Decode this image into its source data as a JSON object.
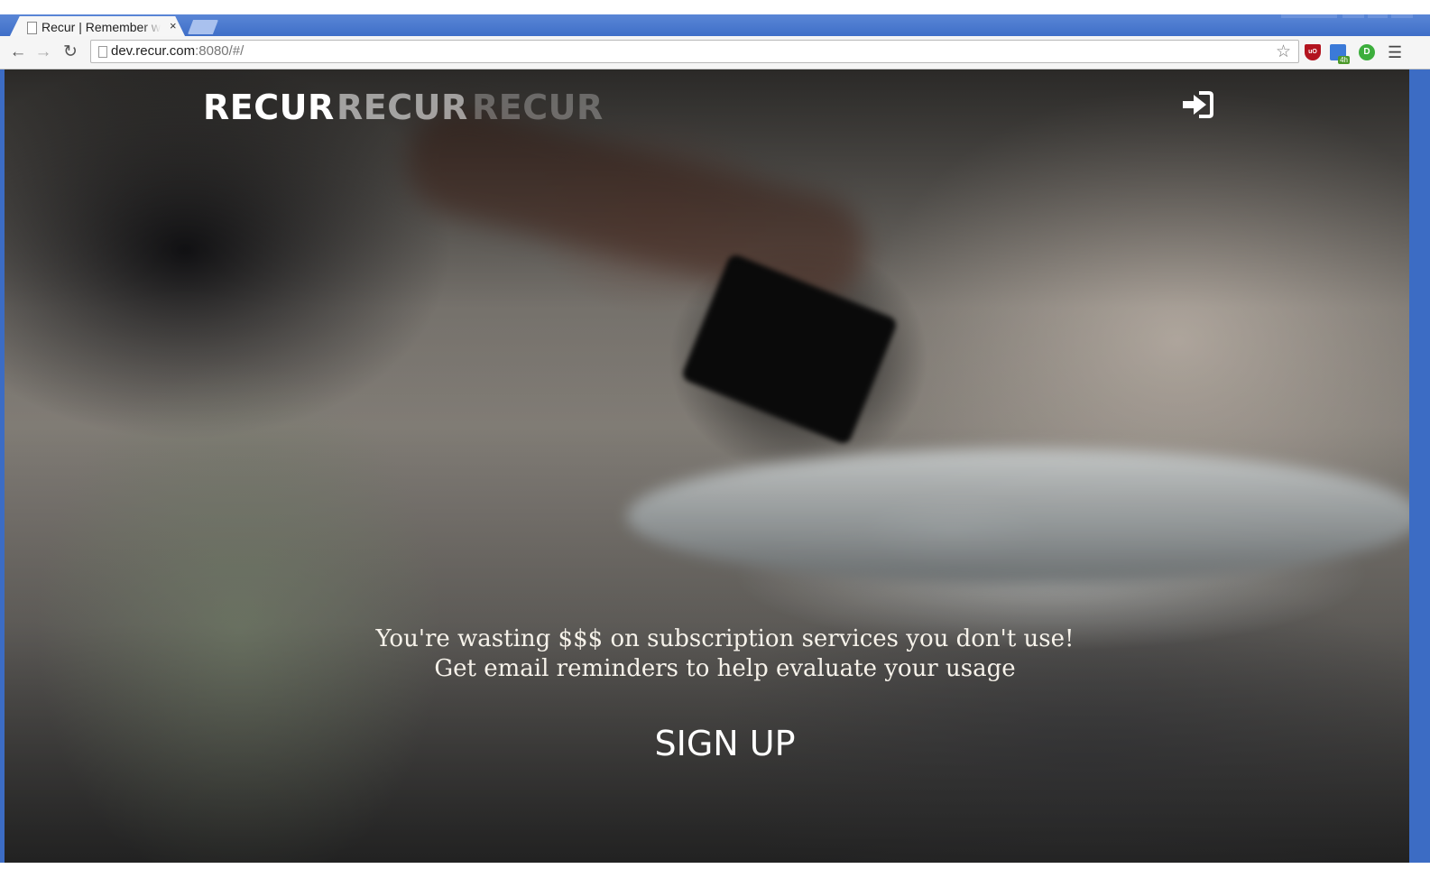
{
  "browser": {
    "tab_title": "Recur | Remember w",
    "tab_close": "×",
    "url_host": "dev.recur.com",
    "url_rest": ":8080/#/",
    "extensions": [
      "ublock-icon",
      "cast-icon",
      "green-d-icon"
    ],
    "ublock_label": "uO",
    "cast_badge": "4h",
    "green_label": "D"
  },
  "header": {
    "brand_words": [
      "RECUR",
      "RECUR",
      "RECUR"
    ]
  },
  "hero": {
    "tagline_line1": "You're wasting $$$ on subscription services you don't use!",
    "tagline_line2": "Get email reminders to help evaluate your usage",
    "signup_label": "SIGN UP"
  },
  "colors": {
    "chrome_blue": "#3c6cc4",
    "text_light": "#f6f2ea"
  }
}
